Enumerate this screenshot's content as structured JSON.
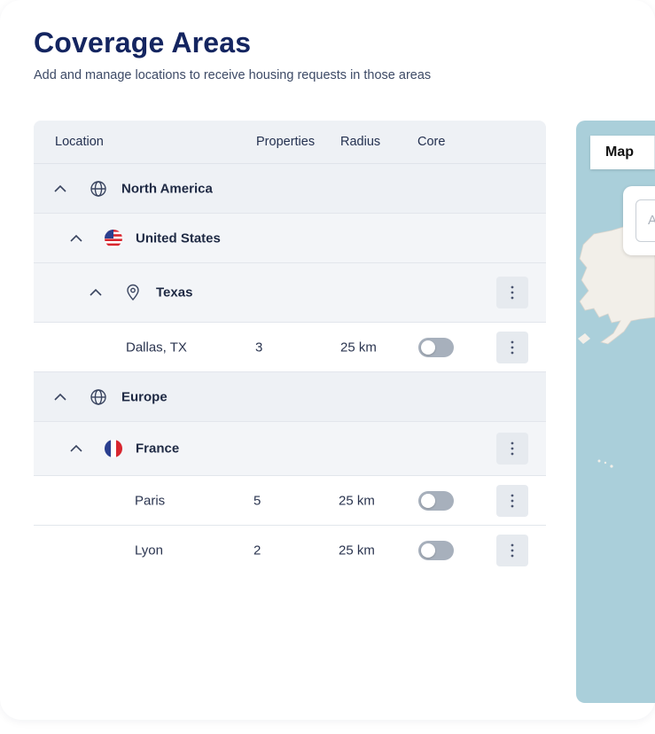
{
  "header": {
    "title": "Coverage Areas",
    "subtitle": "Add and manage locations to receive housing requests in those areas"
  },
  "table": {
    "columns": {
      "location": "Location",
      "properties": "Properties",
      "radius": "Radius",
      "core": "Core"
    },
    "regions": [
      {
        "name": "North America",
        "icon": "globe-icon",
        "countries": [
          {
            "name": "United States",
            "icon": "us-flag-icon",
            "states": [
              {
                "name": "Texas",
                "icon": "map-pin-icon",
                "cities": [
                  {
                    "name": "Dallas, TX",
                    "properties": "3",
                    "radius": "25 km",
                    "core": false
                  }
                ]
              }
            ]
          }
        ]
      },
      {
        "name": "Europe",
        "icon": "globe-icon",
        "countries": [
          {
            "name": "France",
            "icon": "france-flag-icon",
            "cities": [
              {
                "name": "Paris",
                "properties": "5",
                "radius": "25 km",
                "core": false
              },
              {
                "name": "Lyon",
                "properties": "2",
                "radius": "25 km",
                "core": false
              }
            ]
          }
        ]
      }
    ]
  },
  "map": {
    "tab_label": "Map",
    "search_placeholder_visible": "A"
  },
  "colors": {
    "title": "#142560",
    "header_bg": "#eef1f5",
    "toggle_off": "#a7b0bc",
    "map_water": "#aacfda",
    "map_land": "#f2efe9"
  }
}
